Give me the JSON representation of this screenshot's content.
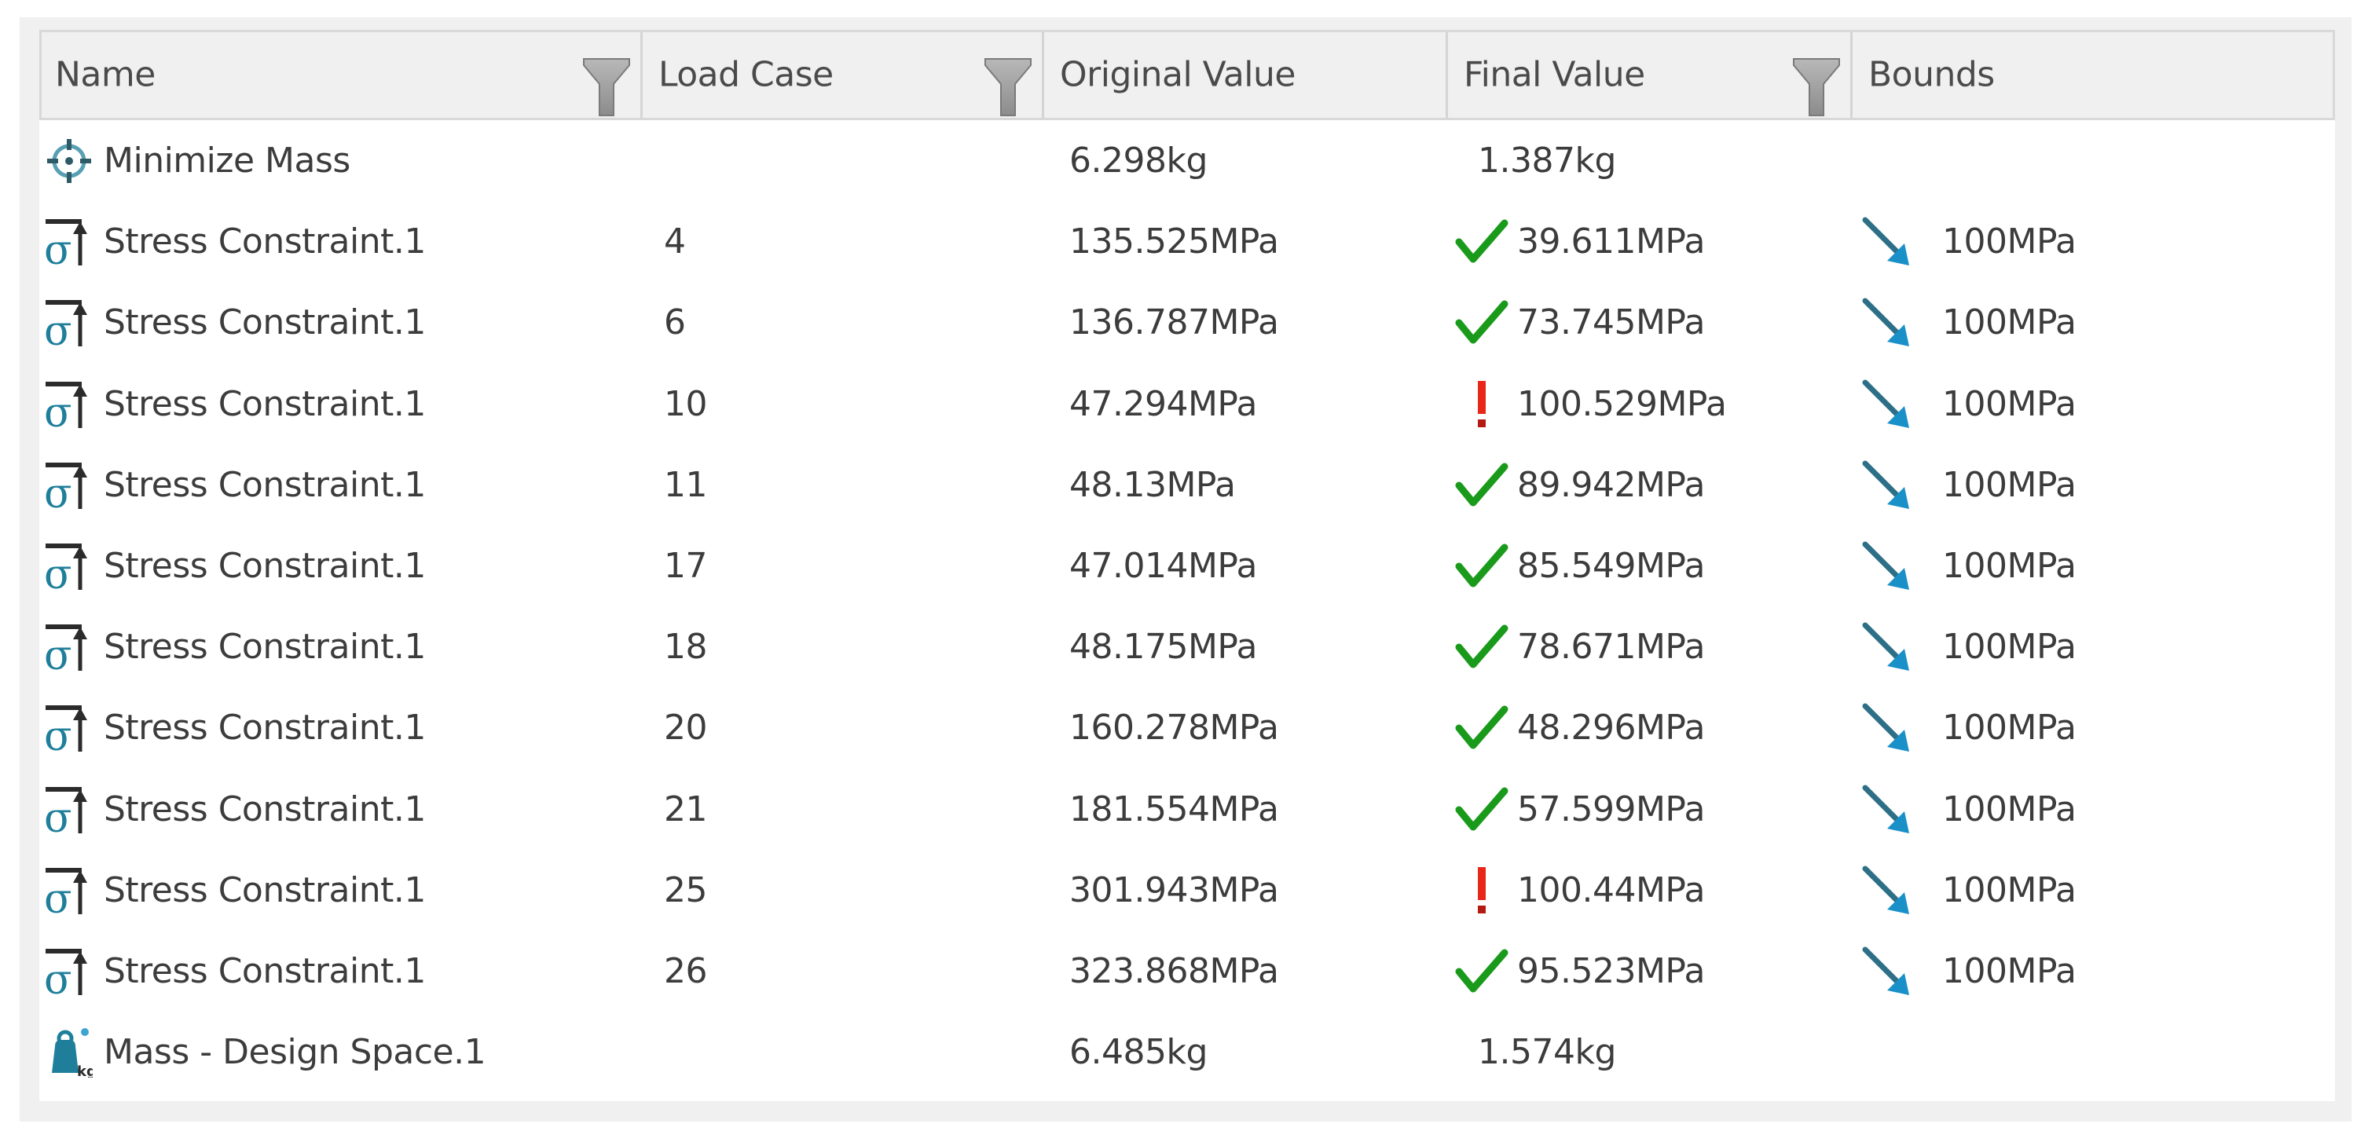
{
  "table": {
    "columns": [
      {
        "key": "name",
        "label": "Name",
        "has_filter": true
      },
      {
        "key": "load_case",
        "label": "Load Case",
        "has_filter": true
      },
      {
        "key": "original_value",
        "label": "Original Value",
        "has_filter": false
      },
      {
        "key": "final_value",
        "label": "Final Value",
        "has_filter": true
      },
      {
        "key": "bounds",
        "label": "Bounds",
        "has_filter": false
      }
    ],
    "rows": [
      {
        "icon": "objective-target-icon",
        "name": "Minimize Mass",
        "load_case": "",
        "original_value": "6.298kg",
        "status": "",
        "final_value": "1.387kg",
        "bound_icon": "",
        "bounds": ""
      },
      {
        "icon": "stress-constraint-icon",
        "name": "Stress Constraint.1",
        "load_case": "4",
        "original_value": "135.525MPa",
        "status": "satisfied",
        "final_value": "39.611MPa",
        "bound_icon": "upper-bound-arrow-icon",
        "bounds": "100MPa"
      },
      {
        "icon": "stress-constraint-icon",
        "name": "Stress Constraint.1",
        "load_case": "6",
        "original_value": "136.787MPa",
        "status": "satisfied",
        "final_value": "73.745MPa",
        "bound_icon": "upper-bound-arrow-icon",
        "bounds": "100MPa"
      },
      {
        "icon": "stress-constraint-icon",
        "name": "Stress Constraint.1",
        "load_case": "10",
        "original_value": "47.294MPa",
        "status": "violated",
        "final_value": "100.529MPa",
        "bound_icon": "upper-bound-arrow-icon",
        "bounds": "100MPa"
      },
      {
        "icon": "stress-constraint-icon",
        "name": "Stress Constraint.1",
        "load_case": "11",
        "original_value": "48.13MPa",
        "status": "satisfied",
        "final_value": "89.942MPa",
        "bound_icon": "upper-bound-arrow-icon",
        "bounds": "100MPa"
      },
      {
        "icon": "stress-constraint-icon",
        "name": "Stress Constraint.1",
        "load_case": "17",
        "original_value": "47.014MPa",
        "status": "satisfied",
        "final_value": "85.549MPa",
        "bound_icon": "upper-bound-arrow-icon",
        "bounds": "100MPa"
      },
      {
        "icon": "stress-constraint-icon",
        "name": "Stress Constraint.1",
        "load_case": "18",
        "original_value": "48.175MPa",
        "status": "satisfied",
        "final_value": "78.671MPa",
        "bound_icon": "upper-bound-arrow-icon",
        "bounds": "100MPa"
      },
      {
        "icon": "stress-constraint-icon",
        "name": "Stress Constraint.1",
        "load_case": "20",
        "original_value": "160.278MPa",
        "status": "satisfied",
        "final_value": "48.296MPa",
        "bound_icon": "upper-bound-arrow-icon",
        "bounds": "100MPa"
      },
      {
        "icon": "stress-constraint-icon",
        "name": "Stress Constraint.1",
        "load_case": "21",
        "original_value": "181.554MPa",
        "status": "satisfied",
        "final_value": "57.599MPa",
        "bound_icon": "upper-bound-arrow-icon",
        "bounds": "100MPa"
      },
      {
        "icon": "stress-constraint-icon",
        "name": "Stress Constraint.1",
        "load_case": "25",
        "original_value": "301.943MPa",
        "status": "violated",
        "final_value": "100.44MPa",
        "bound_icon": "upper-bound-arrow-icon",
        "bounds": "100MPa"
      },
      {
        "icon": "stress-constraint-icon",
        "name": "Stress Constraint.1",
        "load_case": "26",
        "original_value": "323.868MPa",
        "status": "satisfied",
        "final_value": "95.523MPa",
        "bound_icon": "upper-bound-arrow-icon",
        "bounds": "100MPa"
      },
      {
        "icon": "mass-icon",
        "name": "Mass - Design Space.1",
        "load_case": "",
        "original_value": "6.485kg",
        "status": "",
        "final_value": "1.574kg",
        "bound_icon": "",
        "bounds": ""
      }
    ]
  },
  "colors": {
    "satisfied": "#1a9a1a",
    "violated": "#e8261a",
    "bound_arrow_line": "#2c6f86",
    "bound_arrow_head": "#1a90c8",
    "icon_teal": "#1f7f9a",
    "filter_gray": "#8c8c8c"
  }
}
